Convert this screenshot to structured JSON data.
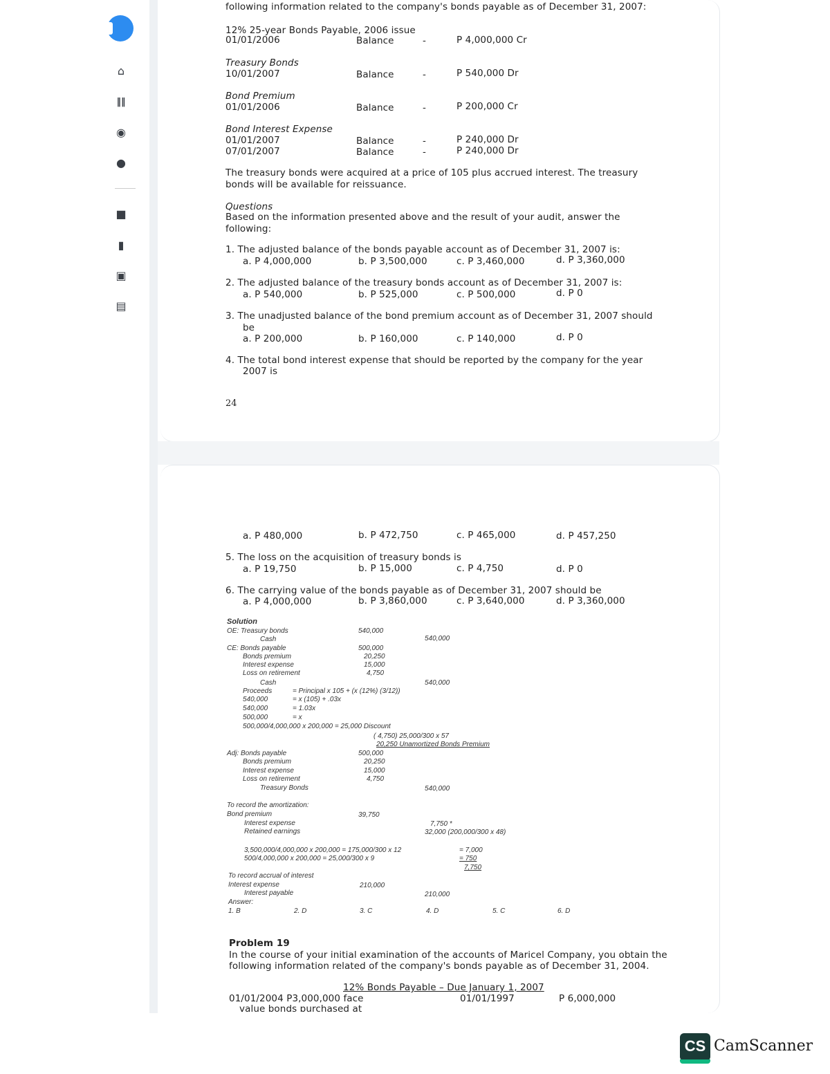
{
  "p1": {
    "intro": "following information related to the company's bonds payable as of December 31, 2007:",
    "bp_title": "12% 25-year Bonds Payable, 2006 issue",
    "bp_date": "01/01/2006",
    "bp_bal": "Balance",
    "bp_amt": "P 4,000,000 Cr",
    "tb_title": "Treasury Bonds",
    "tb_date": "10/01/2007",
    "tb_bal": "Balance",
    "tb_amt": "P 540,000 Dr",
    "pr_title": "Bond Premium",
    "pr_date": "01/01/2006",
    "pr_bal": "Balance",
    "pr_amt": "P 200,000 Cr",
    "ie_title": "Bond Interest Expense",
    "ie_date1": "01/01/2007",
    "ie_bal1": "Balance",
    "ie_amt1": "P 240,000 Dr",
    "ie_date2": "07/01/2007",
    "ie_bal2": "Balance",
    "ie_amt2": "P 240,000 Dr",
    "dash": "-",
    "treasury_l1": "The treasury bonds were acquired at a price of 105 plus accrued interest.  The treasury",
    "treasury_l2": "bonds will be available for reissuance.",
    "questions": "Questions",
    "q_intro_l1": "Based on the information presented above and the result of your audit, answer the",
    "q_intro_l2": "following:",
    "q1": "1.  The adjusted balance of the bonds payable account as of December 31, 2007 is:",
    "q1a": "a.  P 4,000,000",
    "q1b": "b.  P 3,500,000",
    "q1c": "c.  P 3,460,000",
    "q1d": "d.  P 3,360,000",
    "q2": "2.  The adjusted balance of the treasury bonds account as of December 31, 2007 is:",
    "q2a": "a.  P 540,000",
    "q2b": "b.  P 525,000",
    "q2c": "c.  P 500,000",
    "q2d": "d.  P 0",
    "q3_l1": "3.  The unadjusted balance of the bond premium account as of December 31, 2007 should",
    "q3_l2": "be",
    "q3a": "a.  P 200,000",
    "q3b": "b.  P 160,000",
    "q3c": "c.  P 140,000",
    "q3d": "d.  P 0",
    "q4_l1": "4.  The total bond interest expense that should be reported by the company for the year",
    "q4_l2": "2007 is",
    "page_no": "24"
  },
  "p2": {
    "q4a": "a.  P 480,000",
    "q4b": "b.  P 472,750",
    "q4c": "c.  P 465,000",
    "q4d": "d.  P 457,250",
    "q5": "5.  The loss on the acquisition of treasury bonds is",
    "q5a": "a.  P 19,750",
    "q5b": "b.  P 15,000",
    "q5c": "c.  P 4,750",
    "q5d": "d.  P 0",
    "q6": "6.  The carrying value of the bonds payable as of December 31, 2007 should be",
    "q6a": "a.  P 4,000,000",
    "q6b": "b.  P 3,860,000",
    "q6c": "c.  P 3,640,000",
    "q6d": "d.  P 3,360,000"
  },
  "solution": {
    "title": "Solution",
    "oe": "OE: Treasury bonds",
    "oe_amt": "540,000",
    "oe_cash": "Cash",
    "oe_cash_amt": "540,000",
    "ce": "CE: Bonds payable",
    "ce_bp": "500,000",
    "ce_prem": "Bonds premium",
    "ce_prem_amt": "20,250",
    "ce_int": "Interest expense",
    "ce_int_amt": "15,000",
    "ce_loss": "Loss on retirement",
    "ce_loss_amt": "4,750",
    "ce_cash": "Cash",
    "ce_cash_amt": "540,000",
    "calc1a": "Proceeds",
    "calc1b": "= Principal x 105 + (x (12%) (3/12))",
    "calc2a": "540,000",
    "calc2b": "= x (105) + .03x",
    "calc3a": "540,000",
    "calc3b": "= 1.03x",
    "calc4a": "500,000",
    "calc4b": "= x",
    "calc5": "500,000/4,000,000 x 200,000 = 25,000 Discount",
    "calc6": "( 4,750) 25,000/300 x 57",
    "calc7": "20,250 Unamortized Bonds Premium",
    "adj": "Adj: Bonds payable",
    "adj_bp": "500,000",
    "adj_prem": "Bonds premium",
    "adj_prem_amt": "20,250",
    "adj_int": "Interest expense",
    "adj_int_amt": "15,000",
    "adj_loss": "Loss on retirement",
    "adj_loss_amt": "4,750",
    "adj_tb": "Treasury Bonds",
    "adj_tb_amt": "540,000",
    "am_title": "To record the amortization:",
    "am_bp": "Bond premium",
    "am_bp_amt": "39,750",
    "am_int": "Interest expense",
    "am_int_amt": "7,750 *",
    "am_re": "Retained earnings",
    "am_re_amt": "32,000 (200,000/300 x 48)",
    "am_c1": "3,500,000/4,000,000 x 200,000 = 175,000/300 x 12",
    "am_c1r": "= 7,000",
    "am_c2": "500/4,000,000 x 200,000 = 25,000/300 x 9",
    "am_c2r": "=    750",
    "am_c3r": "7,750",
    "acc_title": "To record accrual of interest",
    "acc_int": "Interest expense",
    "acc_int_amt": "210,000",
    "acc_pay": "Interest payable",
    "acc_pay_amt": "210,000",
    "answer": "Answer:",
    "a1": "1.   B",
    "a2": "2.  D",
    "a3": "3. C",
    "a4": "4. D",
    "a5": "5. C",
    "a6": "6. D"
  },
  "problem19": {
    "title": "Problem 19",
    "l1": "In the course of your initial examination of the accounts of Maricel Company, you obtain the",
    "l2": "following information related of the company's bonds payable as of December 31, 2004.",
    "ledger_title": "12% Bonds Payable – Due January 1, 2007",
    "row1a": "01/01/2004 P3,000,000 face",
    "row1b": "01/01/1997",
    "row1c": "P 6,000,000",
    "row2": "value bonds purchased at"
  },
  "watermark": {
    "logo": "CS",
    "name": "CamScanner",
    "color": "#1b3b37"
  },
  "icons": [
    "home-icon",
    "library-icon",
    "globe-icon",
    "clock-icon",
    "folder-icon",
    "book-icon",
    "tag-icon",
    "list-icon"
  ]
}
